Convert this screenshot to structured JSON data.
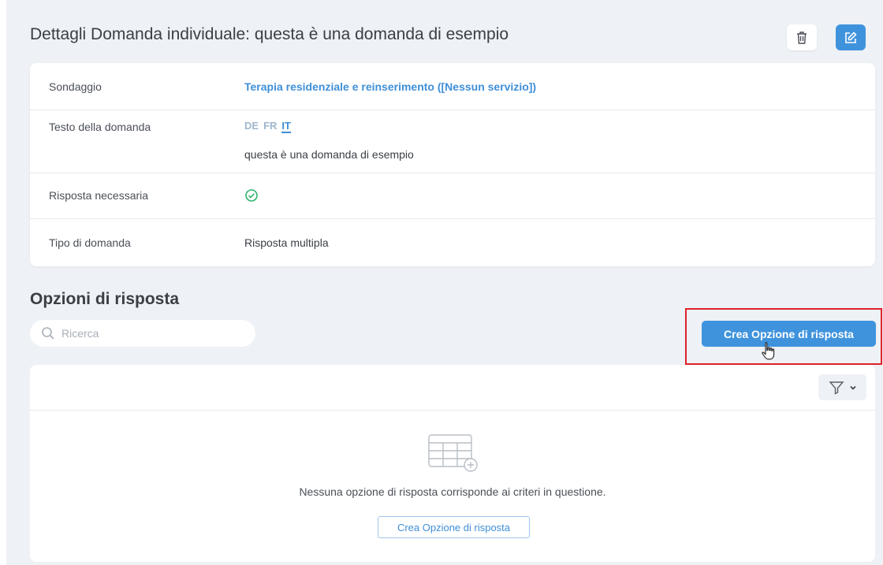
{
  "header": {
    "title": "Dettagli Domanda individuale: questa è una domanda di esempio",
    "delete_icon": "trash-icon",
    "edit_icon": "edit-icon"
  },
  "details": {
    "survey": {
      "label": "Sondaggio",
      "value": "Terapia residenziale e reinserimento ([Nessun servizio])"
    },
    "question_text": {
      "label": "Testo della domanda",
      "languages": [
        "DE",
        "FR",
        "IT"
      ],
      "active_language": "IT",
      "value": "questa è una domanda di esempio"
    },
    "required": {
      "label": "Risposta necessaria",
      "icon": "check-circle-icon",
      "color": "#2fb46c"
    },
    "question_type": {
      "label": "Tipo di domanda",
      "value": "Risposta multipla"
    }
  },
  "answers": {
    "title": "Opzioni di risposta",
    "search_placeholder": "Ricerca",
    "create_button": "Crea Opzione di risposta",
    "empty_message": "Nessuna opzione di risposta corrisponde ai criteri in questione.",
    "empty_create_button": "Crea Opzione di risposta"
  },
  "colors": {
    "accent": "#3f93dd",
    "highlight": "#e0202a",
    "background": "#eef1f5"
  }
}
